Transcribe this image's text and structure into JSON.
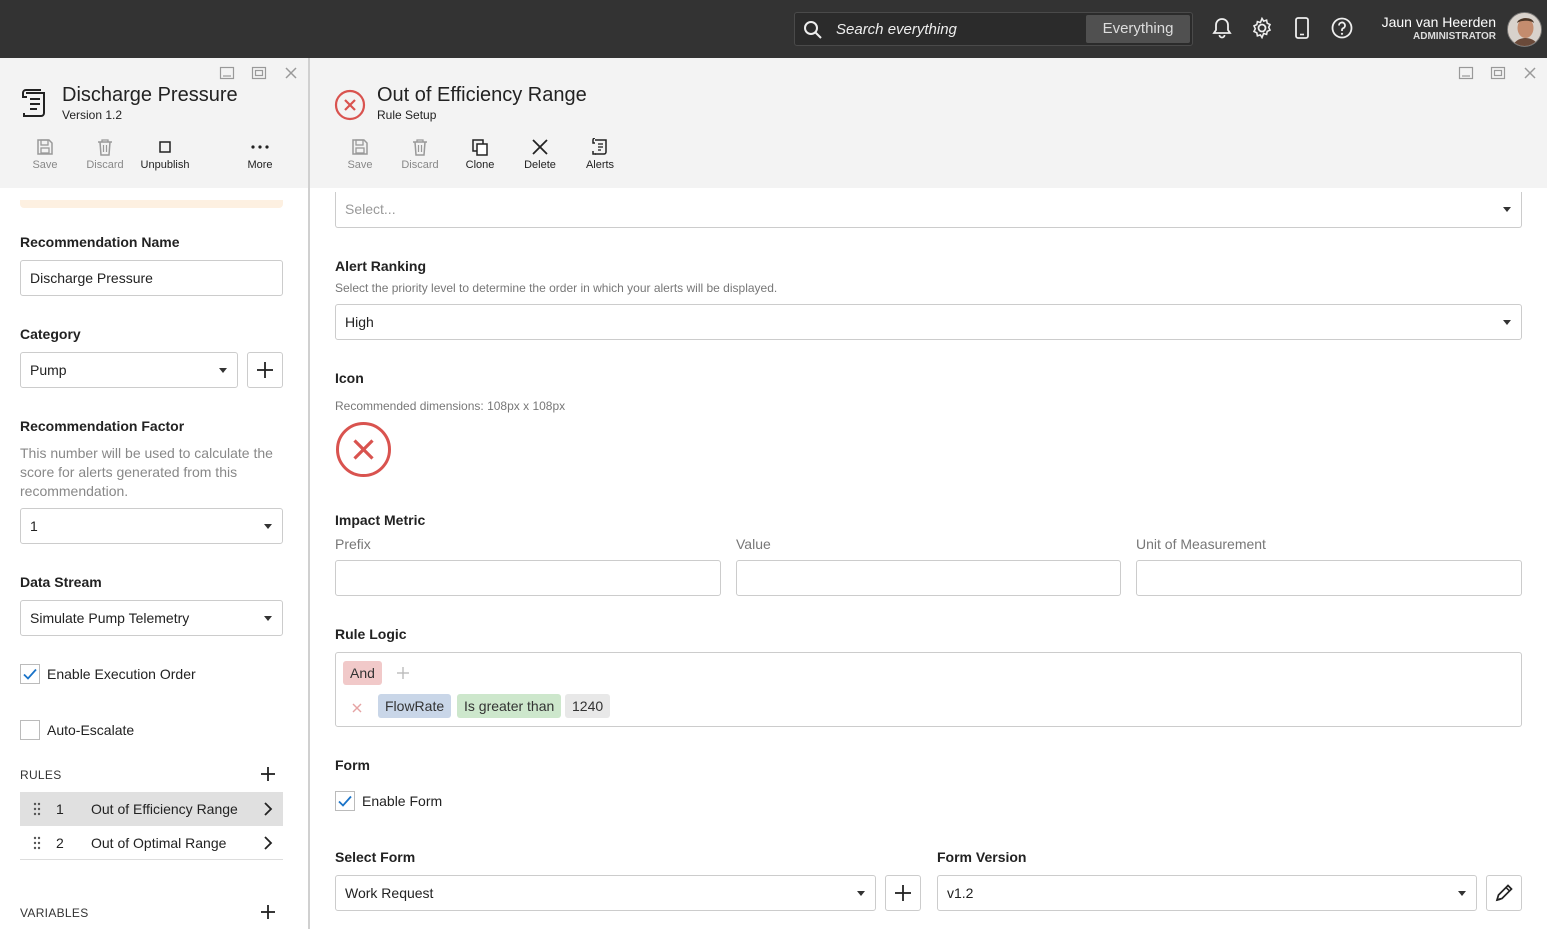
{
  "topbar": {
    "search_placeholder": "Search everything",
    "search_scope": "Everything",
    "user_name": "Jaun van Heerden",
    "user_role": "ADMINISTRATOR"
  },
  "left": {
    "title": "Discharge Pressure",
    "version": "Version 1.2",
    "toolbar": {
      "save": "Save",
      "discard": "Discard",
      "unpublish": "Unpublish",
      "more": "More"
    },
    "recommendation_name_label": "Recommendation Name",
    "recommendation_name_value": "Discharge Pressure",
    "category_label": "Category",
    "category_value": "Pump",
    "factor_label": "Recommendation Factor",
    "factor_hint": "This number will be used to calculate the score for alerts generated from this recommendation.",
    "factor_value": "1",
    "data_stream_label": "Data Stream",
    "data_stream_value": "Simulate Pump Telemetry",
    "enable_execution_order": "Enable Execution Order",
    "auto_escalate": "Auto-Escalate",
    "rules_label": "RULES",
    "rules": [
      {
        "num": "1",
        "name": "Out of Efficiency Range"
      },
      {
        "num": "2",
        "name": "Out of Optimal Range"
      }
    ],
    "variables_label": "VARIABLES"
  },
  "right": {
    "title": "Out of Efficiency Range",
    "subtitle": "Rule Setup",
    "toolbar": {
      "save": "Save",
      "discard": "Discard",
      "clone": "Clone",
      "delete": "Delete",
      "alerts": "Alerts"
    },
    "top_select_placeholder": "Select...",
    "alert_ranking_label": "Alert Ranking",
    "alert_ranking_hint": "Select the priority level to determine the order in which your alerts will be displayed.",
    "alert_ranking_value": "High",
    "icon_label": "Icon",
    "icon_hint": "Recommended dimensions: 108px x 108px",
    "impact_metric_label": "Impact Metric",
    "prefix_label": "Prefix",
    "value_label": "Value",
    "unit_label": "Unit of Measurement",
    "rule_logic_label": "Rule Logic",
    "logic_operator": "And",
    "condition": {
      "field": "FlowRate",
      "operator": "Is greater than",
      "value": "1240"
    },
    "form_label": "Form",
    "enable_form": "Enable Form",
    "select_form_label": "Select Form",
    "select_form_value": "Work Request",
    "form_version_label": "Form Version",
    "form_version_value": "v1.2"
  },
  "colors": {
    "topbar": "#333333",
    "accent_red": "#d9534f",
    "check_blue": "#1a73c8"
  }
}
